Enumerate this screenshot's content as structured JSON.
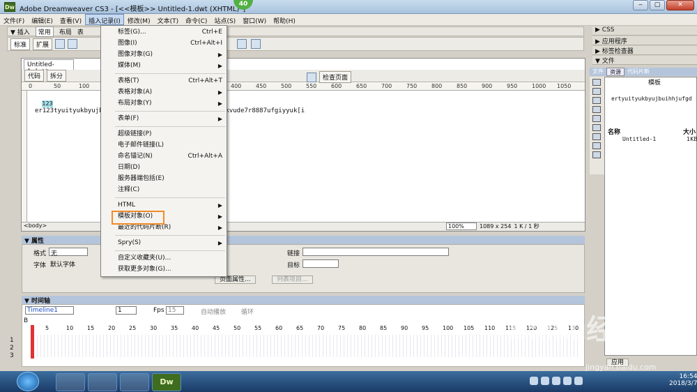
{
  "window": {
    "title": "Adobe Dreamweaver CS3 - [<<模板>> Untitled-1.dwt (XHTML)*]",
    "badge": "40",
    "app_icon": "Dw",
    "btn_min": "‒",
    "btn_max": "▢",
    "btn_close": "✕"
  },
  "menubar": [
    "文件(F)",
    "编辑(E)",
    "查看(V)",
    "插入记录(I)",
    "修改(M)",
    "文本(T)",
    "命令(C)",
    "站点(S)",
    "窗口(W)",
    "帮助(H)"
  ],
  "insert_bar": {
    "title": "▼ 插入",
    "tabs": [
      "常用",
      "布局",
      "表"
    ]
  },
  "mode_buttons": {
    "standard": "标准",
    "extended": "扩展"
  },
  "document": {
    "tab": "Untitled-1.dwt*",
    "code_btn": "代码",
    "split_btn": "拆分",
    "check_page": "检查页面",
    "highlight": "123",
    "text_left": "er123tyuityukbyujb",
    "text_right": "bkvude7r8887ufgiyyuk[i"
  },
  "ruler_ticks": [
    "0",
    "50",
    "100",
    "150",
    "200",
    "250",
    "300",
    "350",
    "400",
    "450",
    "500",
    "550",
    "600",
    "650",
    "700",
    "750",
    "800",
    "850",
    "900",
    "950",
    "1000",
    "1050"
  ],
  "status": {
    "tag": "<body>",
    "zoom": "100%",
    "size": "1089 x 254",
    "weight": "1 K / 1 秒"
  },
  "properties": {
    "title": "▼ 属性",
    "format_label": "格式",
    "format_value": "无",
    "font_label": "字体",
    "font_value": "默认字体",
    "link_label": "链接",
    "target_label": "目标",
    "page_props": "页面属性...",
    "list_item": "列表项目..."
  },
  "timeline": {
    "title": "▼ 时间轴",
    "name": "Timeline1",
    "frame": "1",
    "fps_label": "Fps",
    "fps": "15",
    "autoplay": "自动播放",
    "loop": "循环",
    "frames": [
      "1",
      "5",
      "10",
      "15",
      "20",
      "25",
      "30",
      "35",
      "40",
      "45",
      "50",
      "55",
      "60",
      "65",
      "70",
      "75",
      "80",
      "85",
      "90",
      "95",
      "100",
      "105",
      "110",
      "115",
      "120",
      "125",
      "130"
    ],
    "layers": [
      "B",
      "1",
      "2",
      "3"
    ]
  },
  "right_panel": {
    "headers": [
      "▶ CSS",
      "▶ 应用程序",
      "▶ 标签检查器",
      "▼ 文件"
    ],
    "tabs": [
      "文件",
      "资源",
      "代码片断"
    ],
    "section": "模板",
    "preview": "ertyuityukbyujbuihhjufgd",
    "col_name": "名称",
    "col_size": "大小",
    "file_name": "Untitled-1",
    "file_size": "1KB",
    "apply_btn": "应用"
  },
  "dropdown": [
    {
      "label": "标签(G)...",
      "shortcut": "Ctrl+E"
    },
    {
      "label": "图像(I)",
      "shortcut": "Ctrl+Alt+I"
    },
    {
      "label": "图像对象(G)",
      "submenu": true
    },
    {
      "label": "媒体(M)",
      "submenu": true
    },
    {
      "label": "表格(T)",
      "shortcut": "Ctrl+Alt+T"
    },
    {
      "label": "表格对象(A)",
      "submenu": true
    },
    {
      "label": "布局对象(Y)",
      "submenu": true
    },
    {
      "label": "表单(F)",
      "submenu": true
    },
    {
      "label": "超级链接(P)"
    },
    {
      "label": "电子邮件链接(L)"
    },
    {
      "label": "命名锚记(N)",
      "shortcut": "Ctrl+Alt+A"
    },
    {
      "label": "日期(D)"
    },
    {
      "label": "服务器端包括(E)"
    },
    {
      "label": "注释(C)"
    },
    {
      "label": "HTML",
      "submenu": true
    },
    {
      "label": "模板对象(O)",
      "submenu": true
    },
    {
      "label": "最近的代码片断(R)",
      "submenu": true
    },
    {
      "label": "Spry(S)",
      "submenu": true
    },
    {
      "label": "自定义收藏夹(U)..."
    },
    {
      "label": "获取更多对象(G)..."
    }
  ],
  "taskbar": {
    "time": "16:54",
    "date": "2018/3/7",
    "dw_label": "Dw"
  },
  "watermark": "Baidu经验",
  "watermark_url": "jingyan.baidu.com"
}
